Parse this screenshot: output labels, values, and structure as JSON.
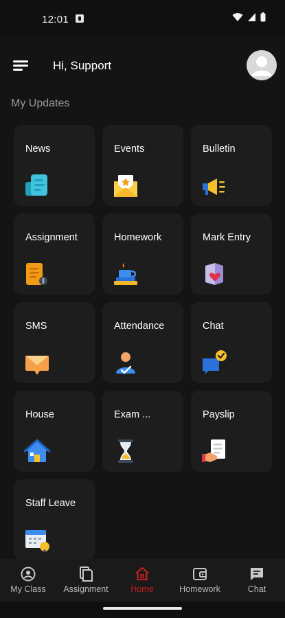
{
  "status_bar": {
    "time": "12:01"
  },
  "header": {
    "greeting": "Hi, Support"
  },
  "section": {
    "title": "My Updates"
  },
  "cards": [
    {
      "label": "News",
      "icon": "news-icon"
    },
    {
      "label": "Events",
      "icon": "events-icon"
    },
    {
      "label": "Bulletin",
      "icon": "bulletin-icon"
    },
    {
      "label": "Assignment",
      "icon": "assignment-icon"
    },
    {
      "label": "Homework",
      "icon": "homework-icon"
    },
    {
      "label": "Mark Entry",
      "icon": "mark-entry-icon"
    },
    {
      "label": "SMS",
      "icon": "sms-icon"
    },
    {
      "label": "Attendance",
      "icon": "attendance-icon"
    },
    {
      "label": "Chat",
      "icon": "chat-icon"
    },
    {
      "label": "House",
      "icon": "house-icon"
    },
    {
      "label": "Exam ...",
      "icon": "exam-icon"
    },
    {
      "label": "Payslip",
      "icon": "payslip-icon"
    },
    {
      "label": "Staff Leave",
      "icon": "staff-leave-icon"
    }
  ],
  "bottom_nav": [
    {
      "label": "My Class",
      "icon": "my-class-icon"
    },
    {
      "label": "Assignment",
      "icon": "assignment-nav-icon"
    },
    {
      "label": "Home",
      "icon": "home-icon",
      "active": true
    },
    {
      "label": "Homework",
      "icon": "homework-nav-icon"
    },
    {
      "label": "Chat",
      "icon": "chat-nav-icon"
    }
  ],
  "colors": {
    "background": "#141414",
    "card": "#1d1d1d",
    "accent": "#c21e1e"
  }
}
